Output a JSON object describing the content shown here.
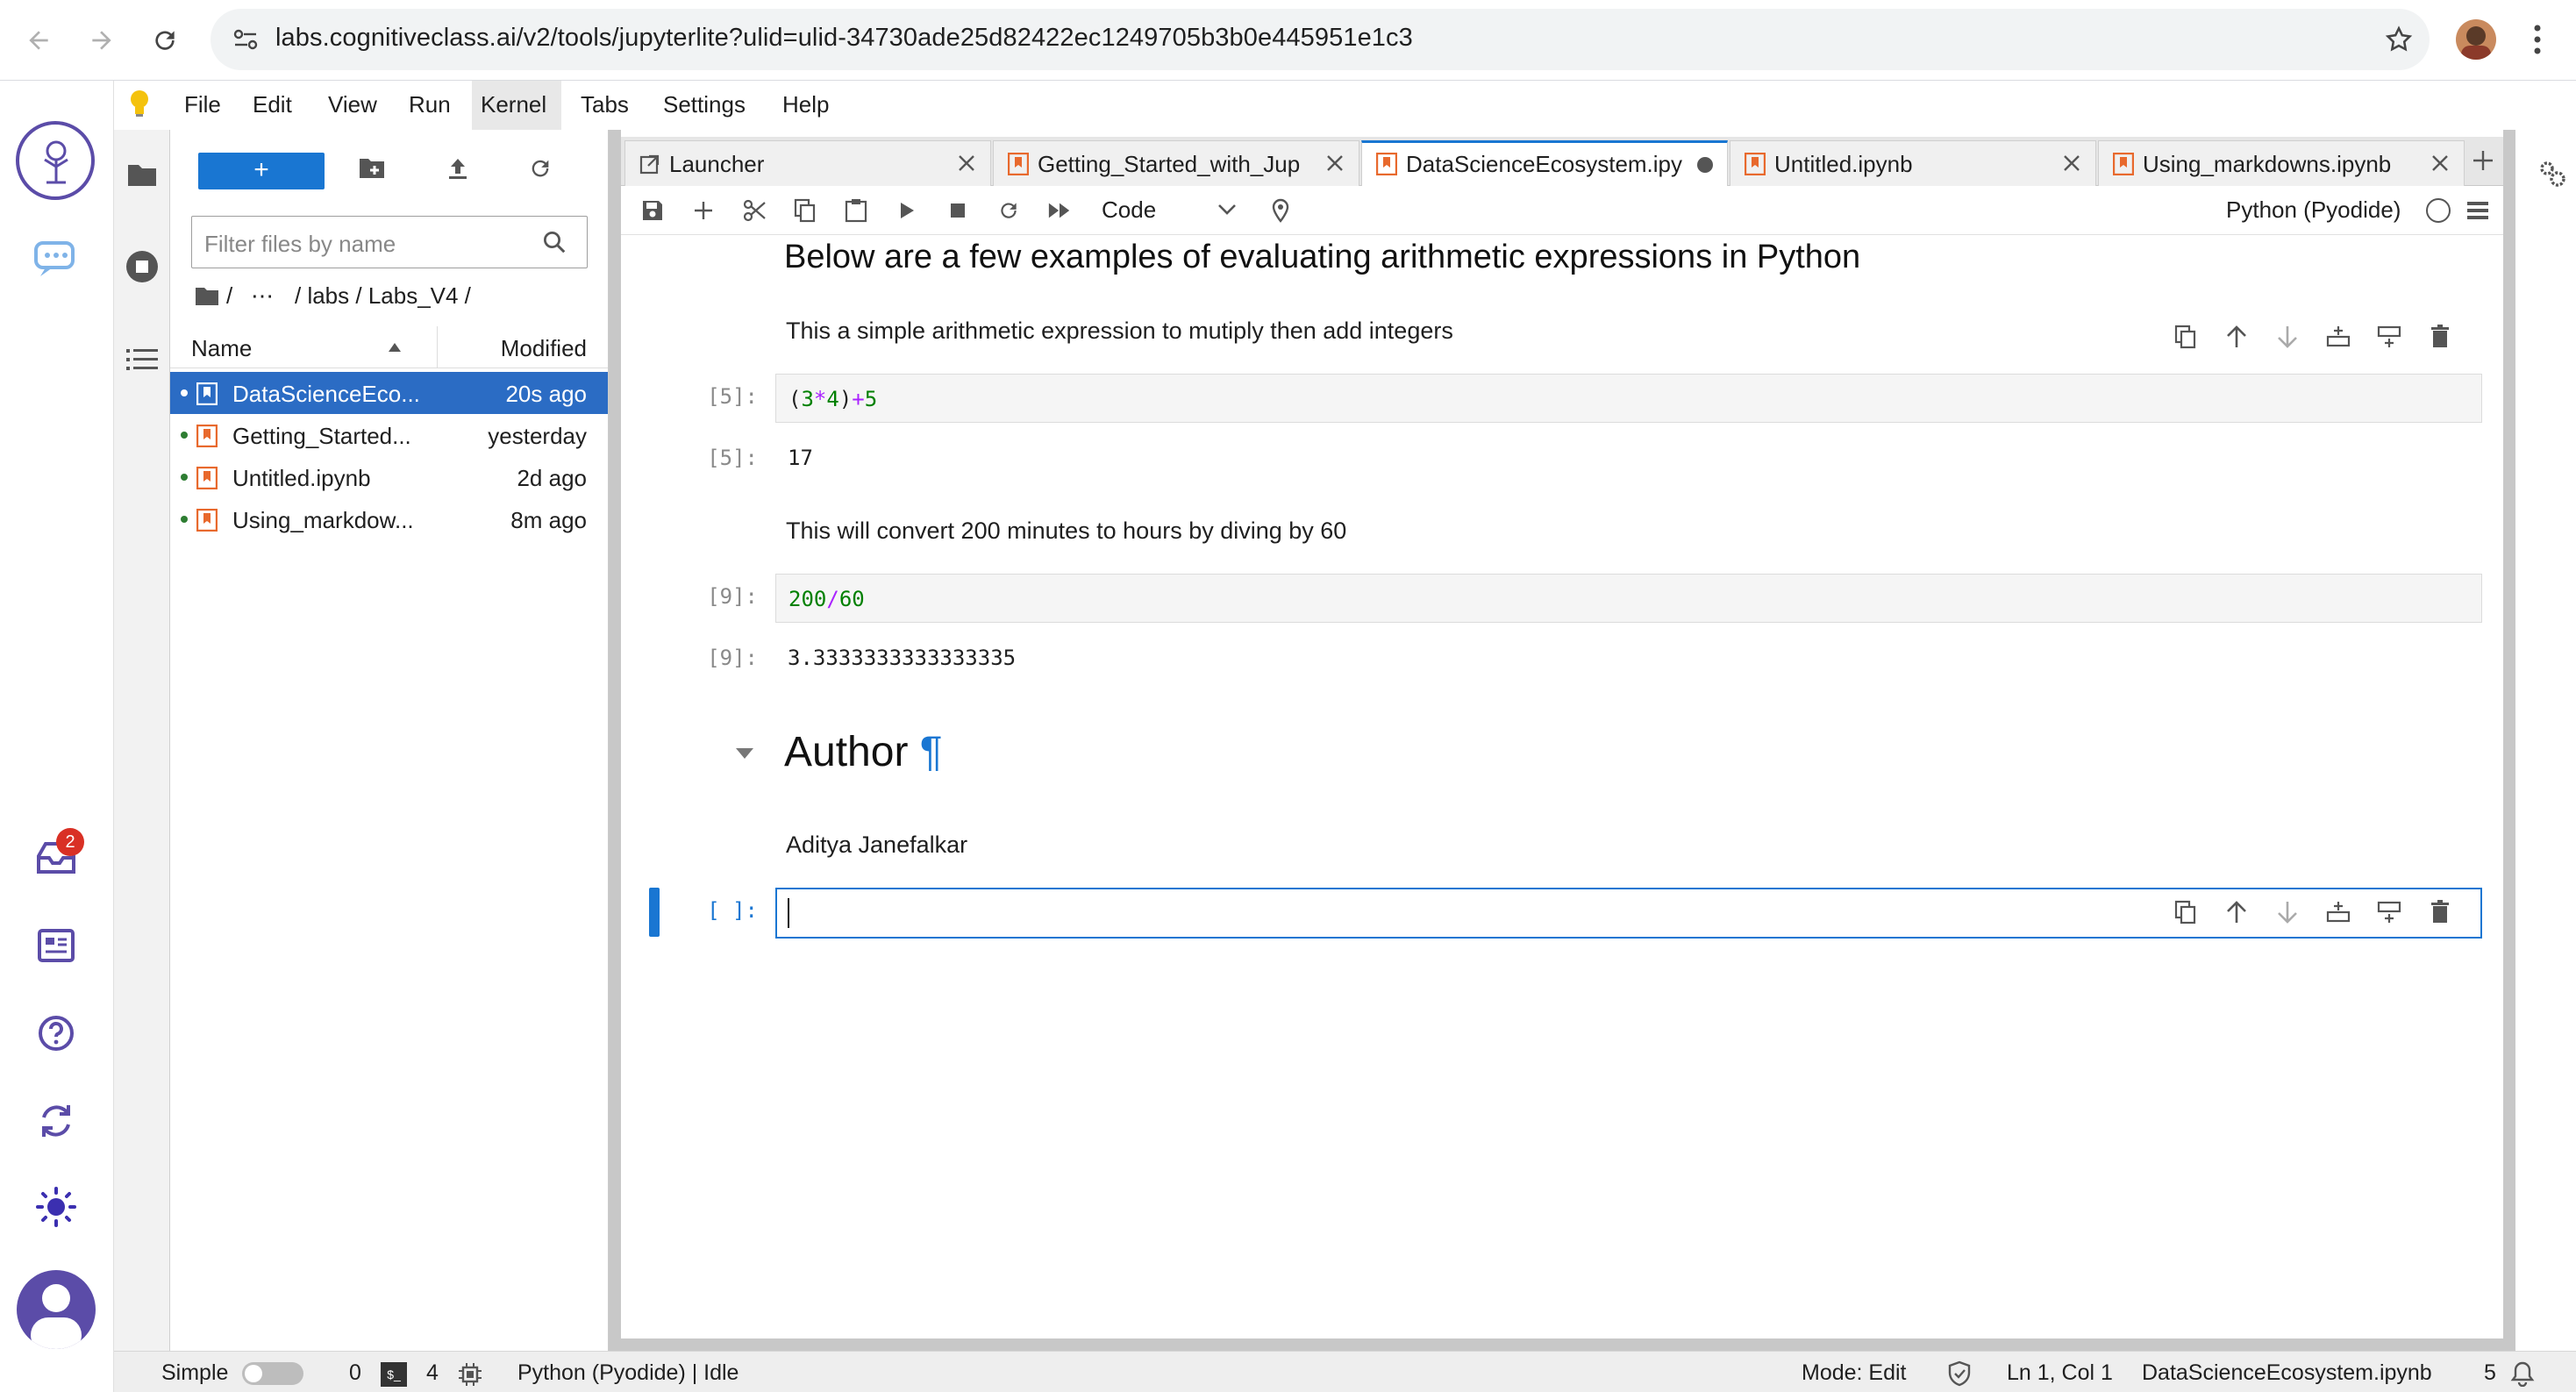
{
  "browser": {
    "url": "labs.cognitiveclass.ai/v2/tools/jupyterlite?ulid=ulid-34730ade25d82422ec1249705b3b0e445951e1c3"
  },
  "activity": {
    "inbox_badge": "2"
  },
  "menu": {
    "items": [
      "File",
      "Edit",
      "View",
      "Run",
      "Kernel",
      "Tabs",
      "Settings",
      "Help"
    ]
  },
  "filebrowser": {
    "new_label": "+",
    "filter_placeholder": "Filter files by name",
    "breadcrumb_sep": "/",
    "breadcrumb_dots": "⋯",
    "breadcrumb_path": "/ labs / Labs_V4 /",
    "col_name": "Name",
    "col_modified": "Modified",
    "files": [
      {
        "name": "DataScienceEco...",
        "modified": "20s ago"
      },
      {
        "name": "Getting_Started...",
        "modified": "yesterday"
      },
      {
        "name": "Untitled.ipynb",
        "modified": "2d ago"
      },
      {
        "name": "Using_markdow...",
        "modified": "8m ago"
      }
    ]
  },
  "tabs": [
    {
      "label": "Launcher"
    },
    {
      "label": "Getting_Started_with_Jup"
    },
    {
      "label": "DataScienceEcosystem.ipy"
    },
    {
      "label": "Untitled.ipynb"
    },
    {
      "label": "Using_markdowns.ipynb"
    }
  ],
  "toolbar": {
    "cell_type": "Code",
    "kernel_name": "Python (Pyodide)"
  },
  "notebook": {
    "heading": "Below are a few examples of evaluating arithmetic expressions in Python",
    "md1": "This a simple arithmetic expression to mutiply then add integers",
    "prompt1": "[5]:",
    "code1_parts": [
      "(",
      "3",
      "*",
      "4",
      ")",
      "+",
      "5"
    ],
    "out_prompt1": "[5]:",
    "out1": "17",
    "md2": "This will convert 200 minutes to hours by diving by 60",
    "prompt2": "[9]:",
    "code2_parts": [
      "200",
      "/",
      "60"
    ],
    "out_prompt2": "[9]:",
    "out2": "3.3333333333333335",
    "author_heading": "Author",
    "pilcrow": "¶",
    "author_name": "Aditya Janefalkar",
    "prompt3": "[ ]:"
  },
  "status": {
    "mode_label": "Simple",
    "terminals": "0",
    "kernels": "4",
    "kernel_status": "Python (Pyodide) | Idle",
    "edit_mode": "Mode: Edit",
    "cursor": "Ln 1, Col 1",
    "filename": "DataScienceEcosystem.ipynb",
    "notifications": "5"
  },
  "colors": {
    "accent": "#1976d2",
    "selected_row": "#2b6cc4",
    "kernel_green": "#2e7d32",
    "notebook_orange": "#e8692d",
    "number_green": "#008000",
    "operator_purple": "#aa22ff"
  }
}
